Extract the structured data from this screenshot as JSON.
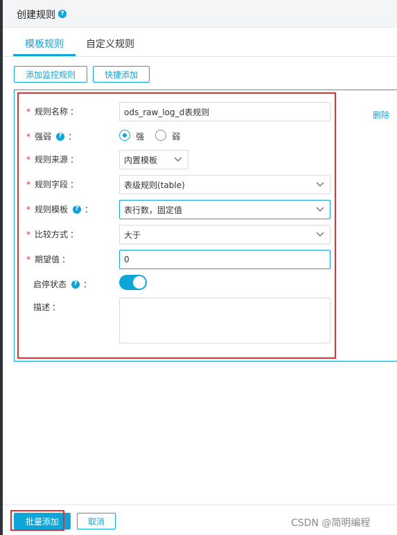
{
  "header": {
    "title": "创建规则",
    "help_icon": "question-icon"
  },
  "tabs": [
    {
      "label": "模板规则",
      "active": true
    },
    {
      "label": "自定义规则",
      "active": false
    }
  ],
  "toolbar": {
    "add_monitor_rule": "添加监控规则",
    "quick_add": "快捷添加"
  },
  "form": {
    "rule_name": {
      "label": "规则名称",
      "suffix": "：",
      "value": "ods_raw_log_d表规则"
    },
    "strength": {
      "label": "强弱",
      "suffix": "：",
      "options": [
        {
          "label": "强",
          "checked": true
        },
        {
          "label": "弱",
          "checked": false
        }
      ]
    },
    "rule_source": {
      "label": "规则来源",
      "suffix": "：",
      "value": "内置模板"
    },
    "rule_field": {
      "label": "规则字段",
      "suffix": "：",
      "value": "表级规则(table)"
    },
    "rule_template": {
      "label": "规则模板",
      "suffix": "：",
      "value": "表行数，固定值"
    },
    "compare_method": {
      "label": "比较方式",
      "suffix": "：",
      "value": "大于"
    },
    "expected_value": {
      "label": "期望值",
      "suffix": "：",
      "value": "0"
    },
    "enable_status": {
      "label": "启停状态",
      "suffix": "：",
      "enabled": true
    },
    "description": {
      "label": "描述",
      "suffix": "：",
      "value": ""
    }
  },
  "delete_label": "删除",
  "footer": {
    "batch_add": "批量添加",
    "cancel": "取消"
  },
  "watermark": "CSDN @简明编程",
  "colors": {
    "accent": "#0ea5d8",
    "required": "#e03131",
    "highlight": "#e03131"
  }
}
